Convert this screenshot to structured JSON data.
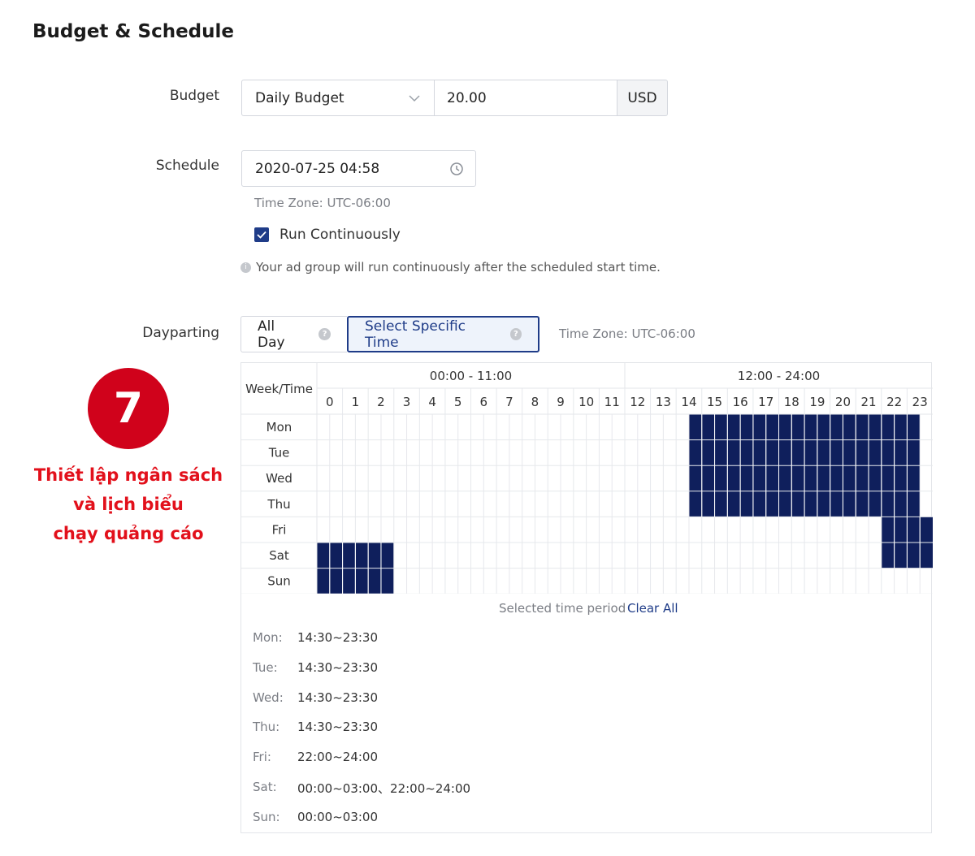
{
  "section_title": "Budget & Schedule",
  "budget": {
    "label": "Budget",
    "type_value": "Daily Budget",
    "amount_value": "20.00",
    "currency": "USD"
  },
  "schedule": {
    "label": "Schedule",
    "start_value": "2020-07-25 04:58",
    "timezone_text": "Time Zone: UTC-06:00",
    "run_continuously_label": "Run Continuously",
    "run_continuously_checked": true,
    "hint_text": "Your ad group will run continuously after the scheduled start time."
  },
  "dayparting": {
    "label": "Dayparting",
    "option_all_day": "All Day",
    "option_specific": "Select Specific Time",
    "selected_option": "Select Specific Time",
    "timezone_text": "Time Zone: UTC-06:00",
    "corner_header": "Week/Time",
    "group_headers": [
      "00:00 - 11:00",
      "12:00 - 24:00"
    ],
    "hours": [
      "0",
      "1",
      "2",
      "3",
      "4",
      "5",
      "6",
      "7",
      "8",
      "9",
      "10",
      "11",
      "12",
      "13",
      "14",
      "15",
      "16",
      "17",
      "18",
      "19",
      "20",
      "21",
      "22",
      "23"
    ],
    "days": [
      "Mon",
      "Tue",
      "Wed",
      "Thu",
      "Fri",
      "Sat",
      "Sun"
    ],
    "selected_ranges": {
      "Mon": [
        [
          14.5,
          23.5
        ]
      ],
      "Tue": [
        [
          14.5,
          23.5
        ]
      ],
      "Wed": [
        [
          14.5,
          23.5
        ]
      ],
      "Thu": [
        [
          14.5,
          23.5
        ]
      ],
      "Fri": [
        [
          22,
          24
        ]
      ],
      "Sat": [
        [
          0,
          3
        ],
        [
          22,
          24
        ]
      ],
      "Sun": [
        [
          0,
          3
        ]
      ]
    },
    "selected_color": "#0f1f5c",
    "summary_title": "Selected time period",
    "clear_all_label": "Clear All",
    "summary": [
      {
        "day": "Mon:",
        "value": "14:30~23:30"
      },
      {
        "day": "Tue:",
        "value": "14:30~23:30"
      },
      {
        "day": "Wed:",
        "value": "14:30~23:30"
      },
      {
        "day": "Thu:",
        "value": "14:30~23:30"
      },
      {
        "day": "Fri:",
        "value": "22:00~24:00"
      },
      {
        "day": "Sat:",
        "value": "00:00~03:00、22:00~24:00"
      },
      {
        "day": "Sun:",
        "value": "00:00~03:00"
      }
    ]
  },
  "annotation": {
    "step_number": "7",
    "lines": [
      "Thiết lập ngân sách",
      "và lịch biểu",
      "chạy quảng cáo"
    ],
    "color": "#e2101b"
  }
}
